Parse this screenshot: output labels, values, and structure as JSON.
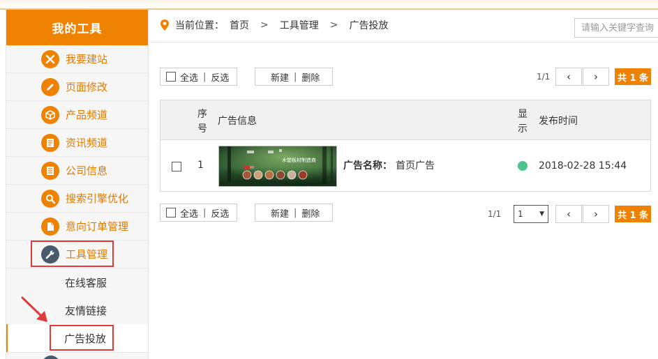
{
  "sidebar": {
    "title": "我的工具",
    "items": [
      {
        "label": "我要建站",
        "icon": "tools-cross-icon"
      },
      {
        "label": "页面修改",
        "icon": "pencil-icon"
      },
      {
        "label": "产品频道",
        "icon": "box-icon"
      },
      {
        "label": "资讯频道",
        "icon": "news-icon"
      },
      {
        "label": "公司信息",
        "icon": "document-icon"
      },
      {
        "label": "搜索引擎优化",
        "icon": "search-icon"
      },
      {
        "label": "意向订单管理",
        "icon": "order-icon"
      },
      {
        "label": "工具管理",
        "icon": "wrench-icon"
      }
    ],
    "subitems": [
      "在线客服",
      "友情链接",
      "广告投放"
    ]
  },
  "breadcrumb": {
    "prefix": "当前位置：",
    "items": [
      "首页",
      "工具管理",
      "广告投放"
    ],
    "separator": ">"
  },
  "search": {
    "placeholder": "请输入关键字查询"
  },
  "toolbar": {
    "select_all": "全选",
    "invert": "反选",
    "new": "新建",
    "delete": "删除",
    "divider": "|",
    "page_info": "1/1",
    "prev": "‹",
    "next": "›",
    "total": "共 1 条",
    "page_select_value": "1"
  },
  "table": {
    "headers": {
      "index_1": "序",
      "index_2": "号",
      "info": "广告信息",
      "show_1": "显",
      "show_2": "示",
      "time": "发布时间"
    },
    "rows": [
      {
        "index": "1",
        "name_label": "广告名称：",
        "name_value": "首页广告",
        "banner_text": "木塑板材制造商",
        "shown": true,
        "time": "2018-02-28 15:44"
      }
    ]
  },
  "colors": {
    "accent": "#ef8200",
    "active_icon": "#4a5a6e",
    "highlight": "#e03a3a",
    "status_on": "#4fc48f"
  }
}
